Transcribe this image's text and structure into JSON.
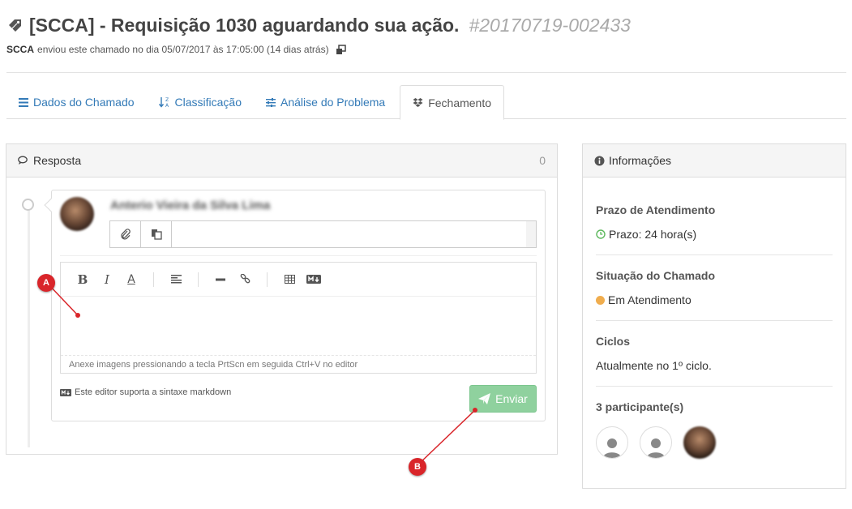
{
  "header": {
    "title": "[SCCA] - Requisição 1030 aguardando sua ação.",
    "ticket_id": "#20170719-002433",
    "sender": "SCCA",
    "sent_text": "enviou este chamado no dia 05/07/2017 às 17:05:00 (14 dias atrás)"
  },
  "tabs": [
    {
      "label": "Dados do Chamado",
      "icon": "list-icon"
    },
    {
      "label": "Classificação",
      "icon": "sort-alpha-icon"
    },
    {
      "label": "Análise do Problema",
      "icon": "sliders-icon"
    },
    {
      "label": "Fechamento",
      "icon": "dropbox-icon",
      "active": true
    }
  ],
  "response": {
    "title": "Resposta",
    "count": "0",
    "author": "Anterio Vieira da Silva Lima",
    "editor_hint": "Anexe imagens pressionando a tecla PrtScn em seguida Ctrl+V no editor",
    "markdown_note": "Este editor suporta a sintaxe markdown",
    "send_label": "Enviar",
    "toolbar": [
      "B",
      "I",
      "A"
    ]
  },
  "info": {
    "title": "Informações",
    "deadline_heading": "Prazo de Atendimento",
    "deadline_value": "Prazo: 24 hora(s)",
    "status_heading": "Situação do Chamado",
    "status_value": "Em Atendimento",
    "status_color": "#f0ad4e",
    "cycles_heading": "Ciclos",
    "cycles_value": "Atualmente no 1º ciclo.",
    "participants_heading": "3 participante(s)"
  },
  "callouts": {
    "a": "A",
    "b": "B"
  },
  "colors": {
    "link": "#337ab7",
    "send": "#8fd19e",
    "callout": "#d9252a"
  }
}
